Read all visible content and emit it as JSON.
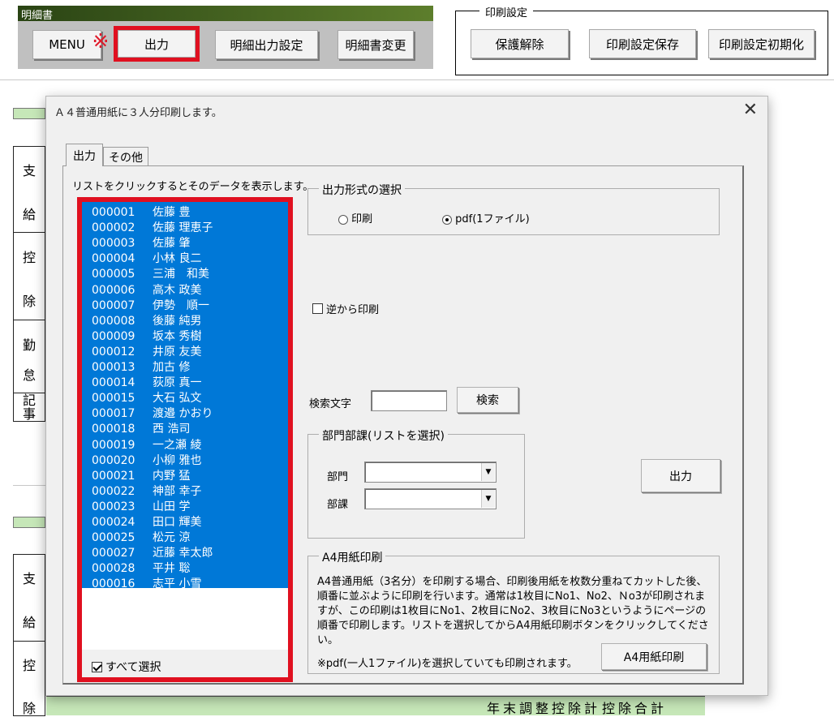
{
  "sheet": {
    "panel_title": "明細書",
    "buttons": {
      "menu": "MENU",
      "menu_mark": "※",
      "output": "出力",
      "detail_output_settings": "明細出力設定",
      "change_statement": "明細書変更"
    },
    "print_settings": {
      "label": "印刷設定",
      "unprotect": "保護解除",
      "save": "印刷設定保存",
      "reset": "印刷設定初期化"
    },
    "row_labels": [
      "支",
      "給",
      "控",
      "除",
      "勤",
      "怠",
      "記",
      "事"
    ],
    "row_labels_2": [
      "支",
      "給",
      "控",
      "除"
    ],
    "bottom_row": [
      "年末調整控除計",
      "控除合計"
    ]
  },
  "dialog": {
    "title": "Ａ４普通用紙に３人分印刷します。",
    "close_icon": "close-icon",
    "tabs": [
      {
        "label": "出力",
        "active": true
      },
      {
        "label": "その他",
        "active": false
      }
    ],
    "list_hint": "リストをクリックするとそのデータを表示します。",
    "employees": [
      {
        "code": "000001",
        "name": "佐藤 豊"
      },
      {
        "code": "000002",
        "name": "佐藤 理恵子"
      },
      {
        "code": "000003",
        "name": "佐藤 肇"
      },
      {
        "code": "000004",
        "name": "小林 良二"
      },
      {
        "code": "000005",
        "name": "三浦　和美"
      },
      {
        "code": "000006",
        "name": "高木 政美"
      },
      {
        "code": "000007",
        "name": "伊勢　順一"
      },
      {
        "code": "000008",
        "name": "後藤 純男"
      },
      {
        "code": "000009",
        "name": "坂本 秀樹"
      },
      {
        "code": "000012",
        "name": "井原 友美"
      },
      {
        "code": "000013",
        "name": "加古 修"
      },
      {
        "code": "000014",
        "name": "荻原 真一"
      },
      {
        "code": "000015",
        "name": "大石 弘文"
      },
      {
        "code": "000017",
        "name": "渡邉 かおり"
      },
      {
        "code": "000018",
        "name": "西 浩司"
      },
      {
        "code": "000019",
        "name": "一之瀬 綾"
      },
      {
        "code": "000020",
        "name": "小柳 雅也"
      },
      {
        "code": "000021",
        "name": "内野 猛"
      },
      {
        "code": "000022",
        "name": "神部 幸子"
      },
      {
        "code": "000023",
        "name": "山田 学"
      },
      {
        "code": "000024",
        "name": "田口 輝美"
      },
      {
        "code": "000025",
        "name": "松元 涼"
      },
      {
        "code": "000027",
        "name": "近藤 幸太郎"
      },
      {
        "code": "000028",
        "name": "平井 聡"
      },
      {
        "code": "000016",
        "name": "志平 小雪"
      }
    ],
    "select_all": {
      "label": "すべて選択",
      "checked": true
    },
    "format_group": {
      "label": "出力形式の選択",
      "options": [
        {
          "label": "印刷",
          "selected": false
        },
        {
          "label": "pdf(1ファイル)",
          "selected": true
        }
      ]
    },
    "reverse_print": {
      "label": "逆から印刷",
      "checked": false
    },
    "search": {
      "label": "検索文字",
      "value": "",
      "button": "検索"
    },
    "dept_group": {
      "label": "部門部課(リストを選択)",
      "dept_label": "部門",
      "dept_value": "",
      "section_label": "部課",
      "section_value": ""
    },
    "output_button": "出力",
    "a4_group": {
      "label": "A4用紙印刷",
      "description": "A4普通用紙（3名分）を印刷する場合、印刷後用紙を枚数分重ねてカットした後、順番に並ぶように印刷を行います。通常は1枚目にNo1、No2、Ｎo3が印刷されますが、この印刷は1枚目にNo1、2枚目にNo2、3枚目にNo3というようにページの順番で印刷します。リストを選択してからA4用紙印刷ボタンをクリックしてください。",
      "note": "※pdf(一人1ファイル)を選択していても印刷されます。",
      "button": "A4用紙印刷"
    }
  },
  "colors": {
    "selection": "#0078d7",
    "highlight": "#e01020",
    "sheet_green": "#c6e7b8"
  }
}
